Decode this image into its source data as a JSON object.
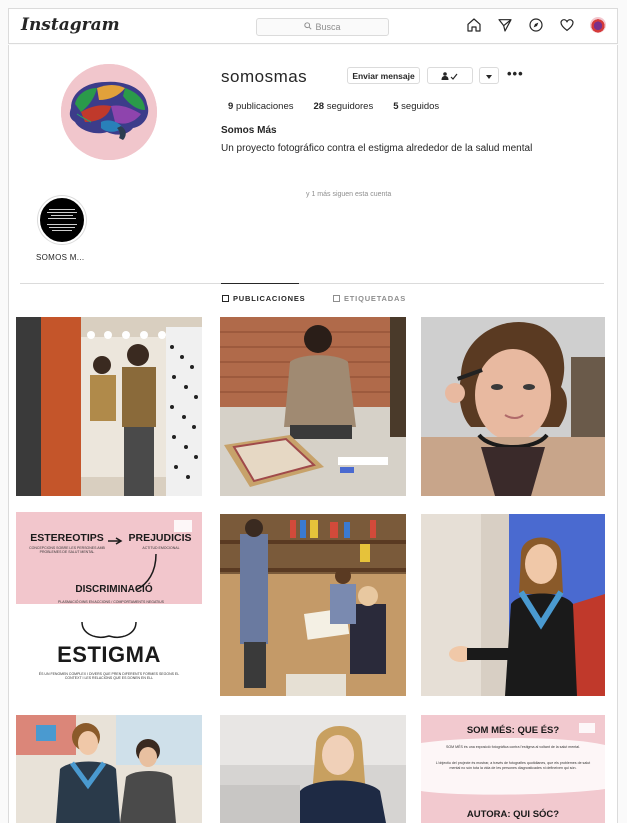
{
  "header": {
    "logo": "Instagram",
    "search_placeholder": "Busca",
    "icons": [
      "home-icon",
      "direct-icon",
      "explore-icon",
      "heart-icon",
      "profile-avatar"
    ]
  },
  "profile": {
    "username": "somosmas",
    "message_button": "Enviar mensaje",
    "stats": {
      "posts_count": "9",
      "posts_label": "publicaciones",
      "followers_count": "28",
      "followers_label": "seguidores",
      "following_count": "5",
      "following_label": "seguidos"
    },
    "full_name": "Somos Más",
    "bio": "Un proyecto fotográfico contra el estigma alrededor de la salud mental",
    "followed_by": "y 1 más siguen esta cuenta"
  },
  "highlights": [
    {
      "label": "SOMOS M..."
    }
  ],
  "tabs": [
    {
      "label": "PUBLICACIONES",
      "active": true
    },
    {
      "label": "ETIQUETADAS",
      "active": false
    }
  ],
  "posts": {
    "p4": {
      "word1": "ESTEREOTIPS",
      "word2": "PREJUDICIS",
      "word3": "DISCRIMINACIÓ",
      "word4": "ESTIGMA",
      "sub1": "CONCEPCIONS SOBRE LES PERSONES AMB PROBLEMES DE SALUT MENTAL",
      "sub2": "ACTITUD EMOCIONAL",
      "sub3": "PLASMACIÓ DINS EN ACCIONS / COMPORTAMENTS NEGATIUS",
      "sub4": "ÉS UN FENOMEN COMPLEX I DIVERS QUE PREN DIFERENTS FORMES SEGONS EL CONTEXT I LES RELACIONS QUE ES DONEN EN ELL"
    },
    "p9": {
      "title": "SOM MÉS: QUE ÉS?",
      "line1": "SOM MÉS és una exposició fotogràfica contra l'estigma al voltant de la salut mental.",
      "line2": "L'objectiu del projecte és mostrar, a través de fotografies quotidianes, que els problemes de salut mental no són tota la vida de les persones diagnosticades ni defineixen qui són.",
      "subtitle": "AUTORA: QUI SÓC?"
    }
  },
  "colors": {
    "border": "#dbdbdb",
    "muted": "#8e8e8e",
    "pink": "#f2c6cc",
    "text": "#262626"
  }
}
